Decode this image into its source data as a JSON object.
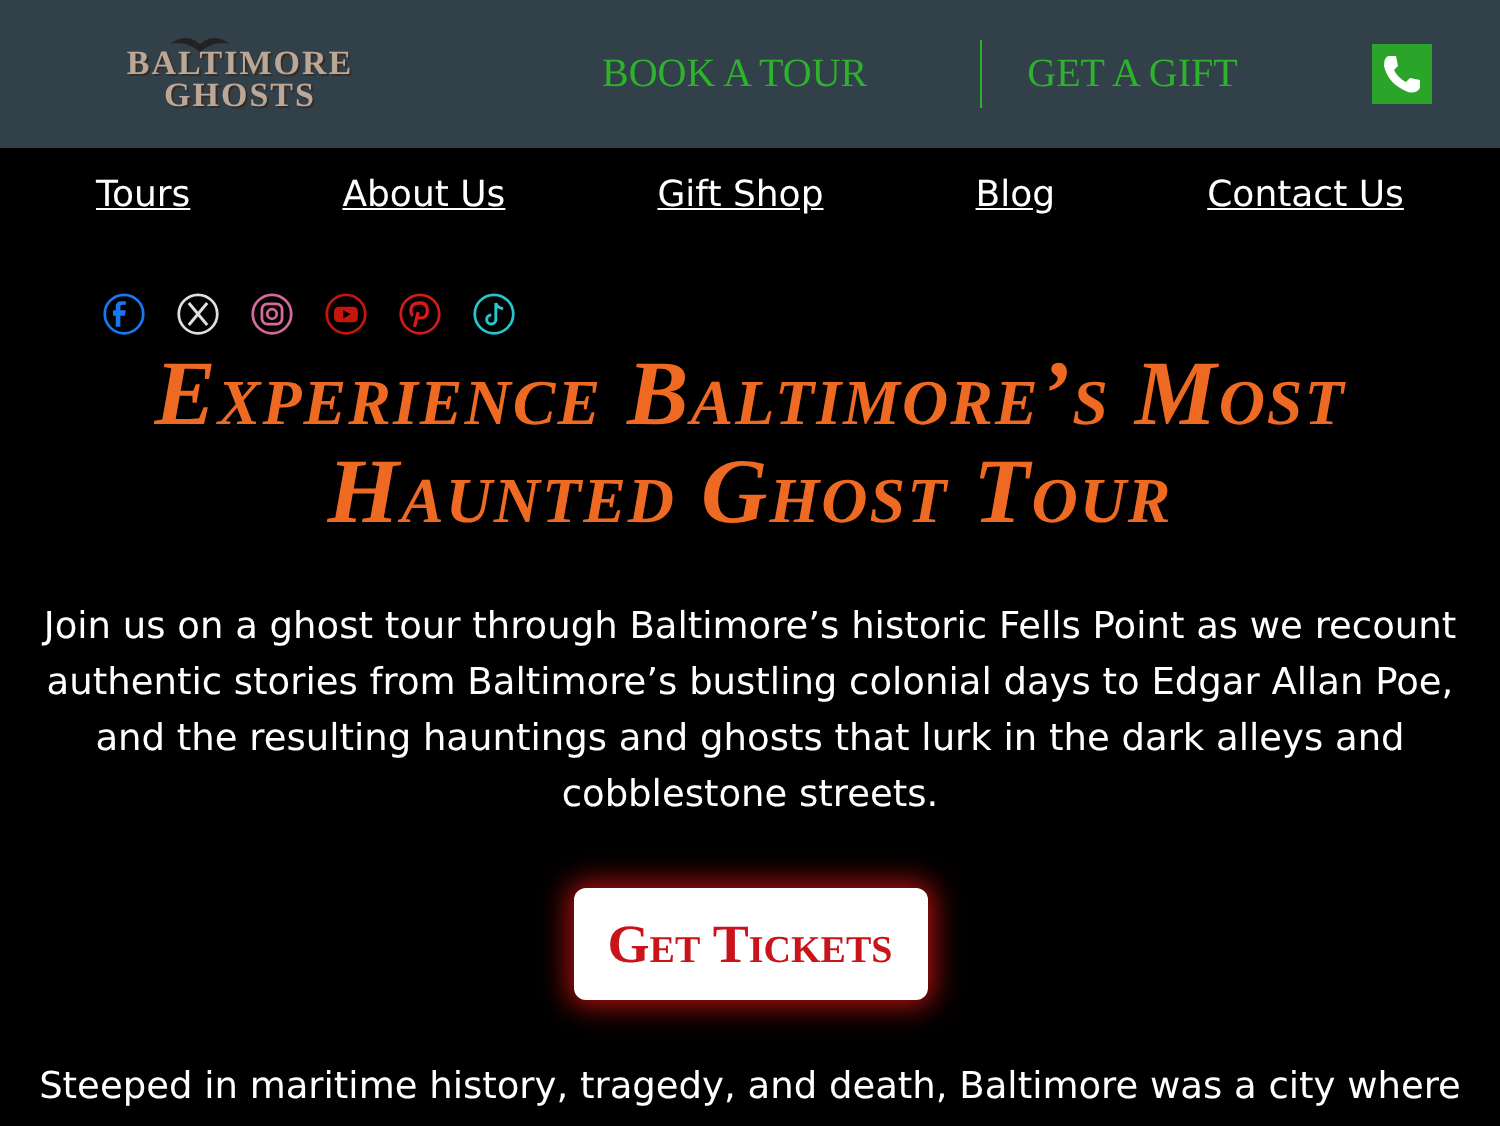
{
  "header": {
    "logo": {
      "line_1": "BALTIMORE",
      "line_2": "GHOSTS"
    },
    "links": [
      {
        "label": "BOOK A TOUR"
      },
      {
        "label": "GET A GIFT"
      }
    ]
  },
  "nav": [
    {
      "label": "Tours"
    },
    {
      "label": "About Us"
    },
    {
      "label": "Gift Shop"
    },
    {
      "label": "Blog"
    },
    {
      "label": "Contact Us"
    }
  ],
  "social": [
    {
      "kind": "facebook",
      "color": "#1877f2"
    },
    {
      "kind": "x",
      "color": "#e0e0e0"
    },
    {
      "kind": "instagram",
      "color": "#d46a9a"
    },
    {
      "kind": "youtube",
      "color": "#c4160f"
    },
    {
      "kind": "pinterest",
      "color": "#d41a1a"
    },
    {
      "kind": "tiktok",
      "color": "#25c6cf"
    }
  ],
  "hero": {
    "title": "Experience Baltimore’s Most Haunted Ghost Tour",
    "intro": "Join us on a ghost tour through Baltimore’s historic Fells Point as we recount authentic stories from Baltimore’s bustling colonial days to Edgar Allan Poe, and the resulting hauntings and ghosts that lurk in the dark alleys and cobblestone streets.",
    "button": "Get Tickets",
    "next_paragraph": "Steeped in maritime history, tragedy, and death, Baltimore was a city where"
  }
}
